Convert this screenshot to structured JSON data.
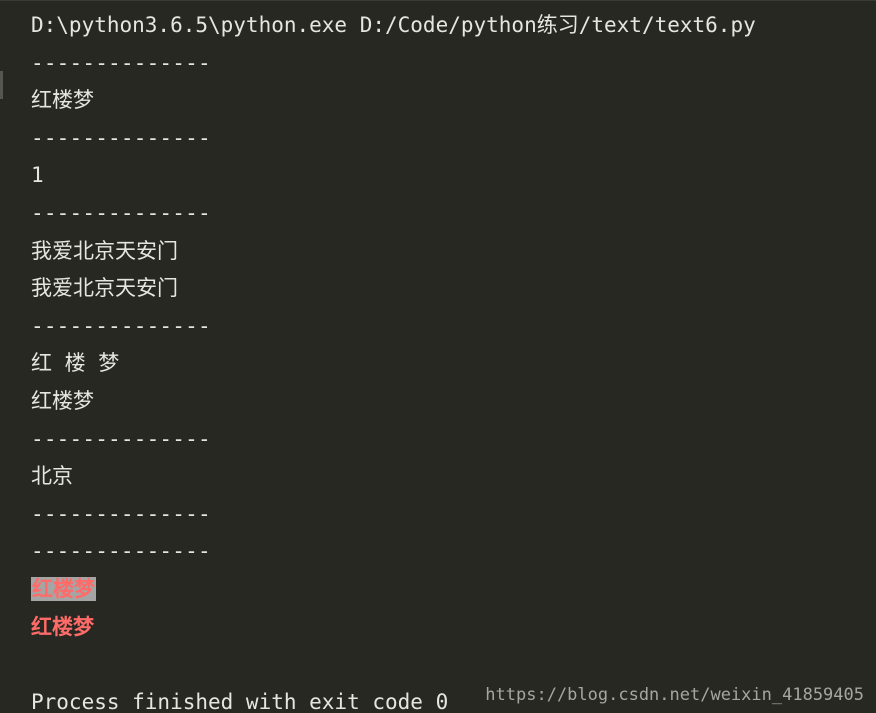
{
  "console": {
    "lines": [
      {
        "text": "D:\\python3.6.5\\python.exe D:/Code/python练习/text/text6.py",
        "style": "normal"
      },
      {
        "text": "--------------",
        "style": "dash"
      },
      {
        "text": "红楼梦",
        "style": "normal"
      },
      {
        "text": "--------------",
        "style": "dash"
      },
      {
        "text": "1",
        "style": "normal"
      },
      {
        "text": "--------------",
        "style": "dash"
      },
      {
        "text": "我爱北京天安门",
        "style": "normal"
      },
      {
        "text": "我爱北京天安门",
        "style": "normal"
      },
      {
        "text": "--------------",
        "style": "dash"
      },
      {
        "text": "红 楼 梦",
        "style": "normal"
      },
      {
        "text": "红楼梦",
        "style": "normal"
      },
      {
        "text": "--------------",
        "style": "dash"
      },
      {
        "text": "北京",
        "style": "normal"
      },
      {
        "text": "--------------",
        "style": "dash"
      },
      {
        "text": "--------------",
        "style": "dash"
      },
      {
        "text": "红楼梦",
        "style": "highlight-red"
      },
      {
        "text": "红楼梦",
        "style": "red"
      },
      {
        "text": "",
        "style": "normal"
      },
      {
        "text": "Process finished with exit code 0",
        "style": "normal"
      }
    ]
  },
  "watermark": {
    "text": "https://blog.csdn.net/weixin_41859405"
  },
  "colors": {
    "background": "#272822",
    "text": "#e6e6e0",
    "red": "#ff6b68",
    "highlight": "#a5a5a5"
  }
}
